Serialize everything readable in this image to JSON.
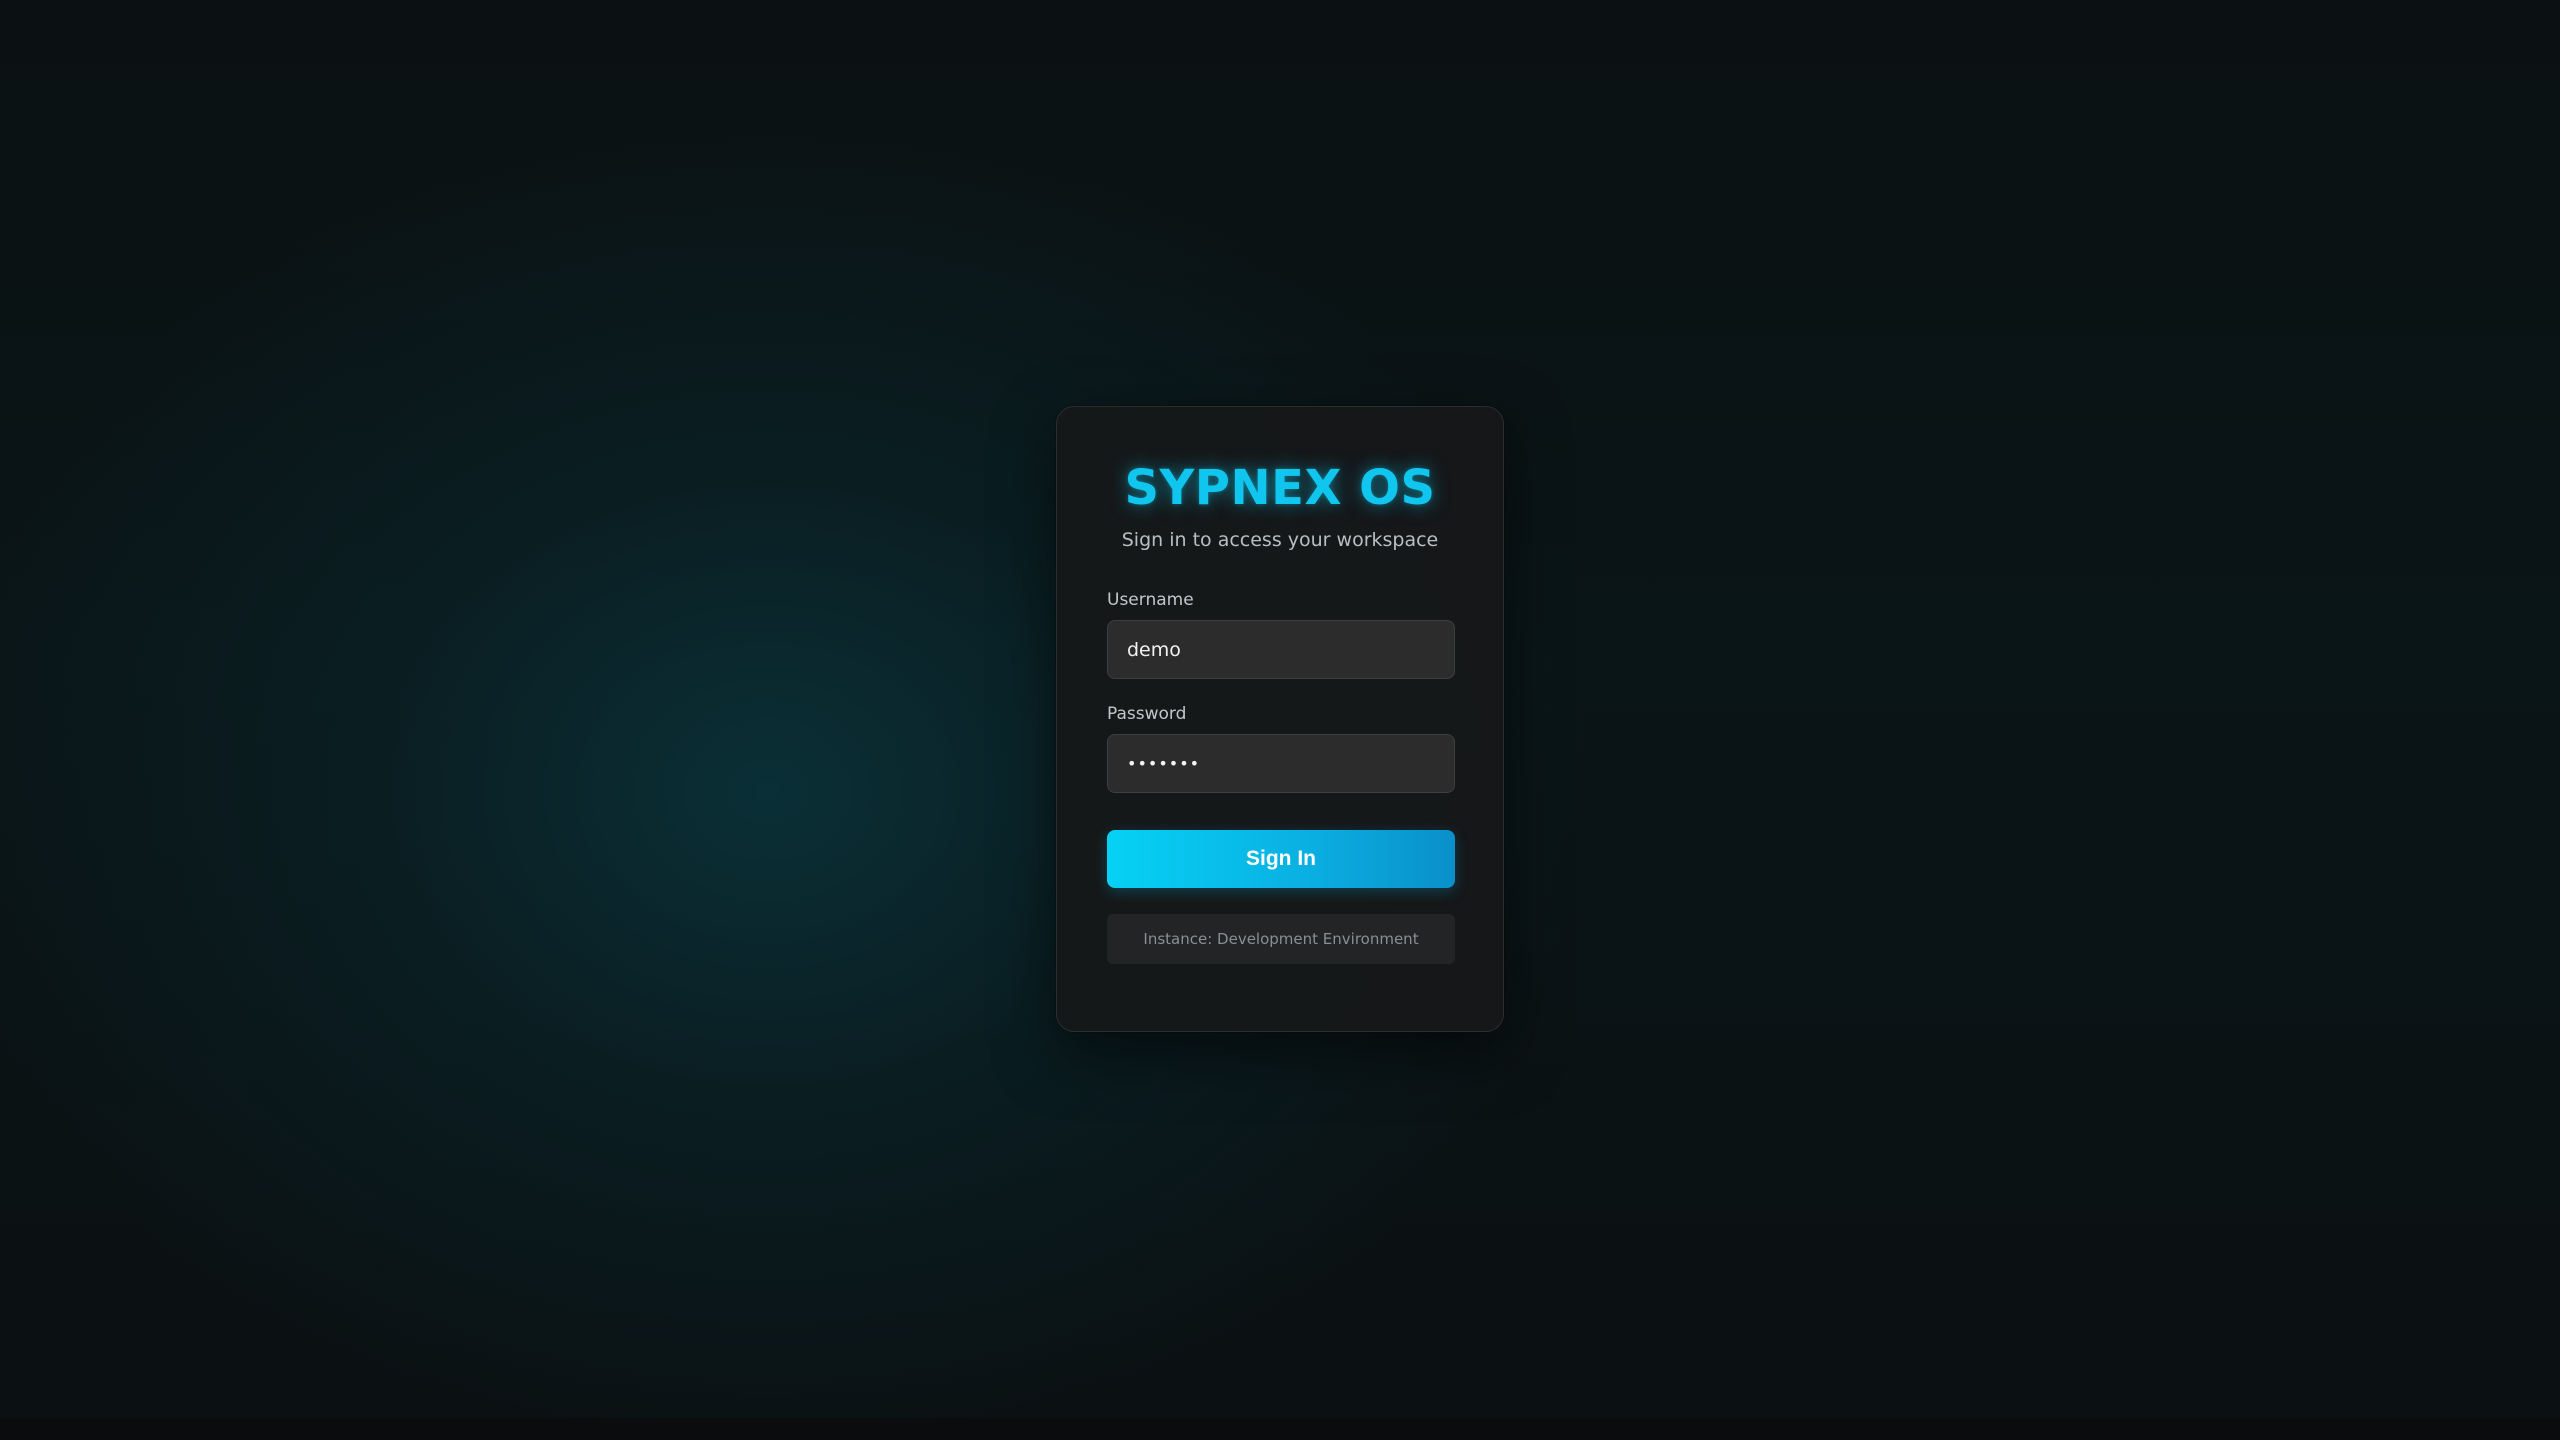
{
  "app": {
    "title": "SYPNEX OS",
    "subtitle": "Sign in to access your workspace"
  },
  "form": {
    "username": {
      "label": "Username",
      "value": "demo"
    },
    "password": {
      "label": "Password",
      "value": "•••••••"
    },
    "submit_label": "Sign In"
  },
  "footer": {
    "instance_text": "Instance: Development Environment"
  },
  "colors": {
    "accent": "#10c6ee",
    "button_start": "#06d2f5",
    "button_end": "#0a8fc9",
    "card_background": "#161819",
    "page_background": "#0b0f11"
  }
}
